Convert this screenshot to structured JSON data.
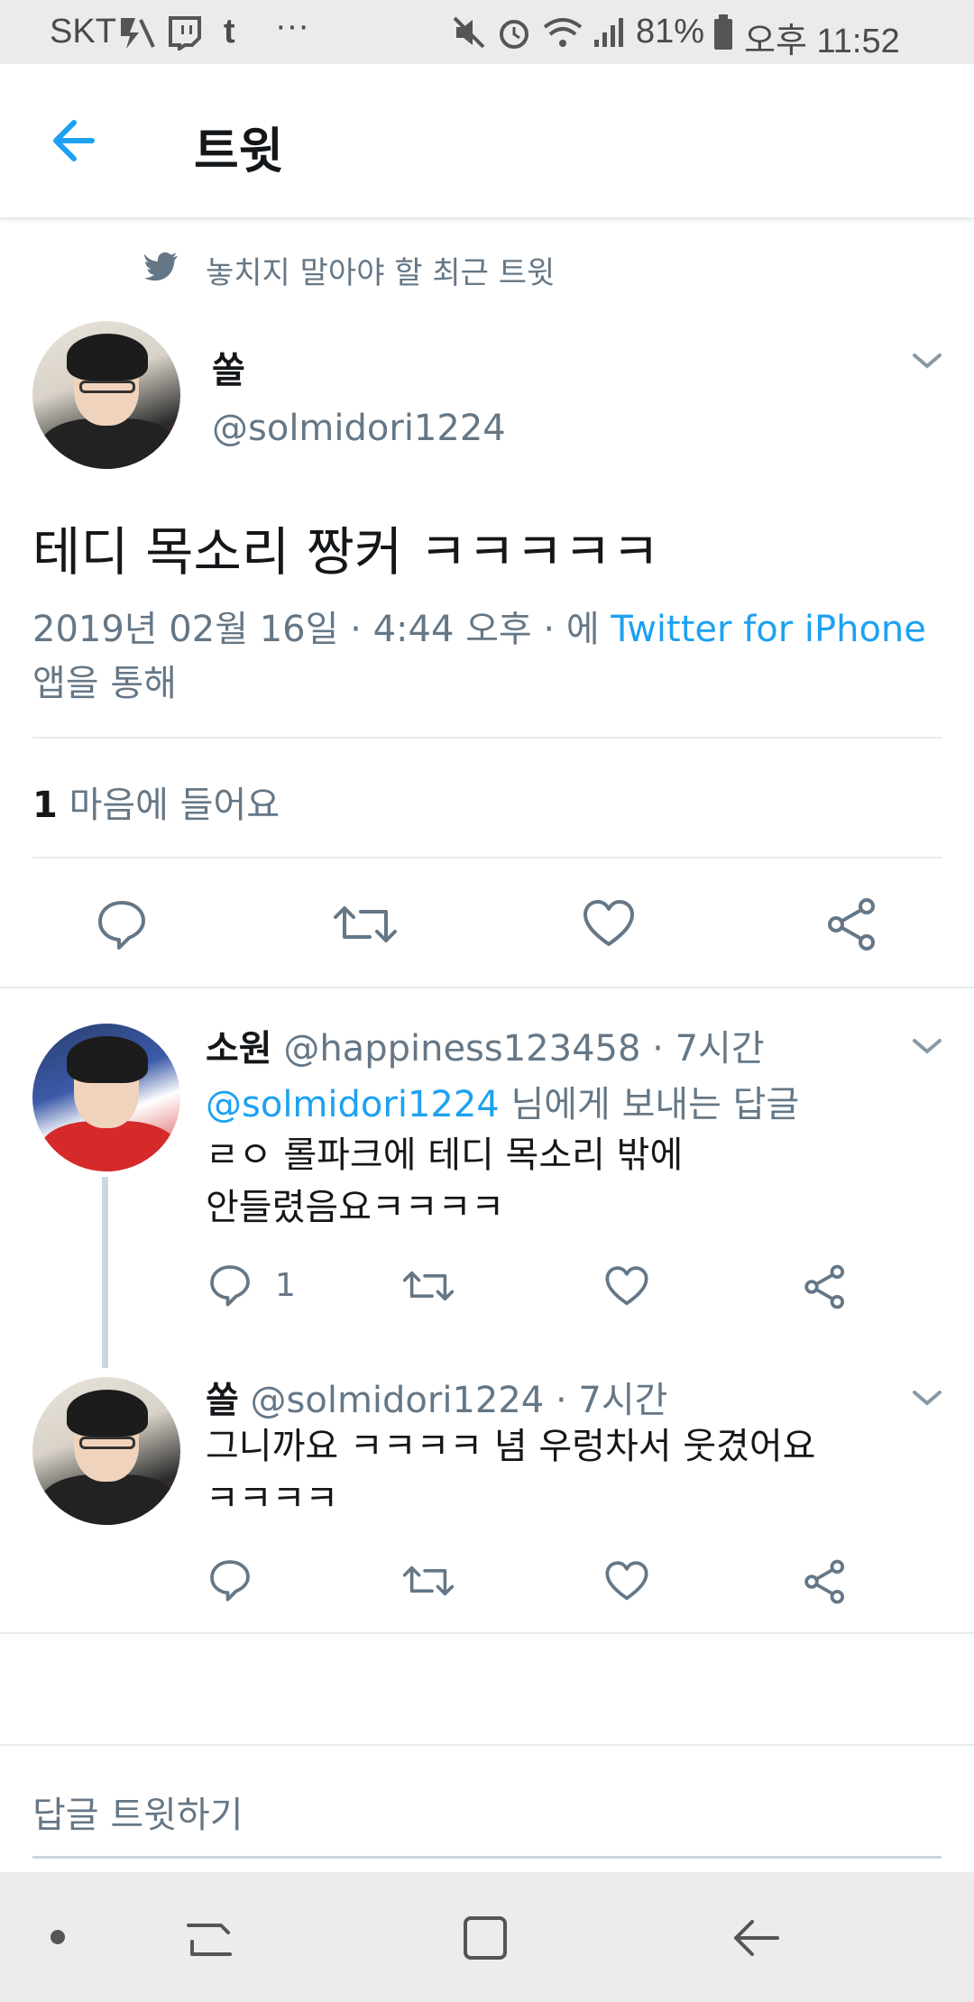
{
  "status_bar": {
    "carrier": "SKT",
    "more": "···",
    "battery": "81%",
    "time": "오후 11:52"
  },
  "header": {
    "title": "트윗"
  },
  "context": {
    "label": "놓치지 말아야 할 최근 트윗"
  },
  "main_tweet": {
    "name": "쏠",
    "handle": "@solmidori1224",
    "text": "테디 목소리 짱커 ㅋㅋㅋㅋㅋ",
    "meta_date": "2019년 02월 16일 · 4:44 오후 · 에 ",
    "meta_source": "Twitter for iPhone",
    "meta_suffix": "앱을 통해",
    "likes_count": "1",
    "likes_label": "마음에 들어요"
  },
  "replies": [
    {
      "name": "소원",
      "handle": "@happiness123458 · 7시간",
      "reply_to_handle": "@solmidori1224",
      "reply_to_suffix": " 님에게 보내는 답글",
      "text_line1": "ㄹㅇ 롤파크에 테디 목소리 밖에",
      "text_line2": "안들렸음요ㅋㅋㅋㅋ",
      "reply_count": "1"
    },
    {
      "name": "쏠",
      "handle": "@solmidori1224 · 7시간",
      "text_line1": "그니까요 ㅋㅋㅋㅋ 념 우렁차서 웃겼어요",
      "text_line2": "ㅋㅋㅋㅋ"
    }
  ],
  "compose": {
    "placeholder": "답글 트윗하기"
  },
  "colors": {
    "accent": "#1da1f2",
    "secondary_text": "#657786",
    "divider": "#e6ecf0"
  }
}
